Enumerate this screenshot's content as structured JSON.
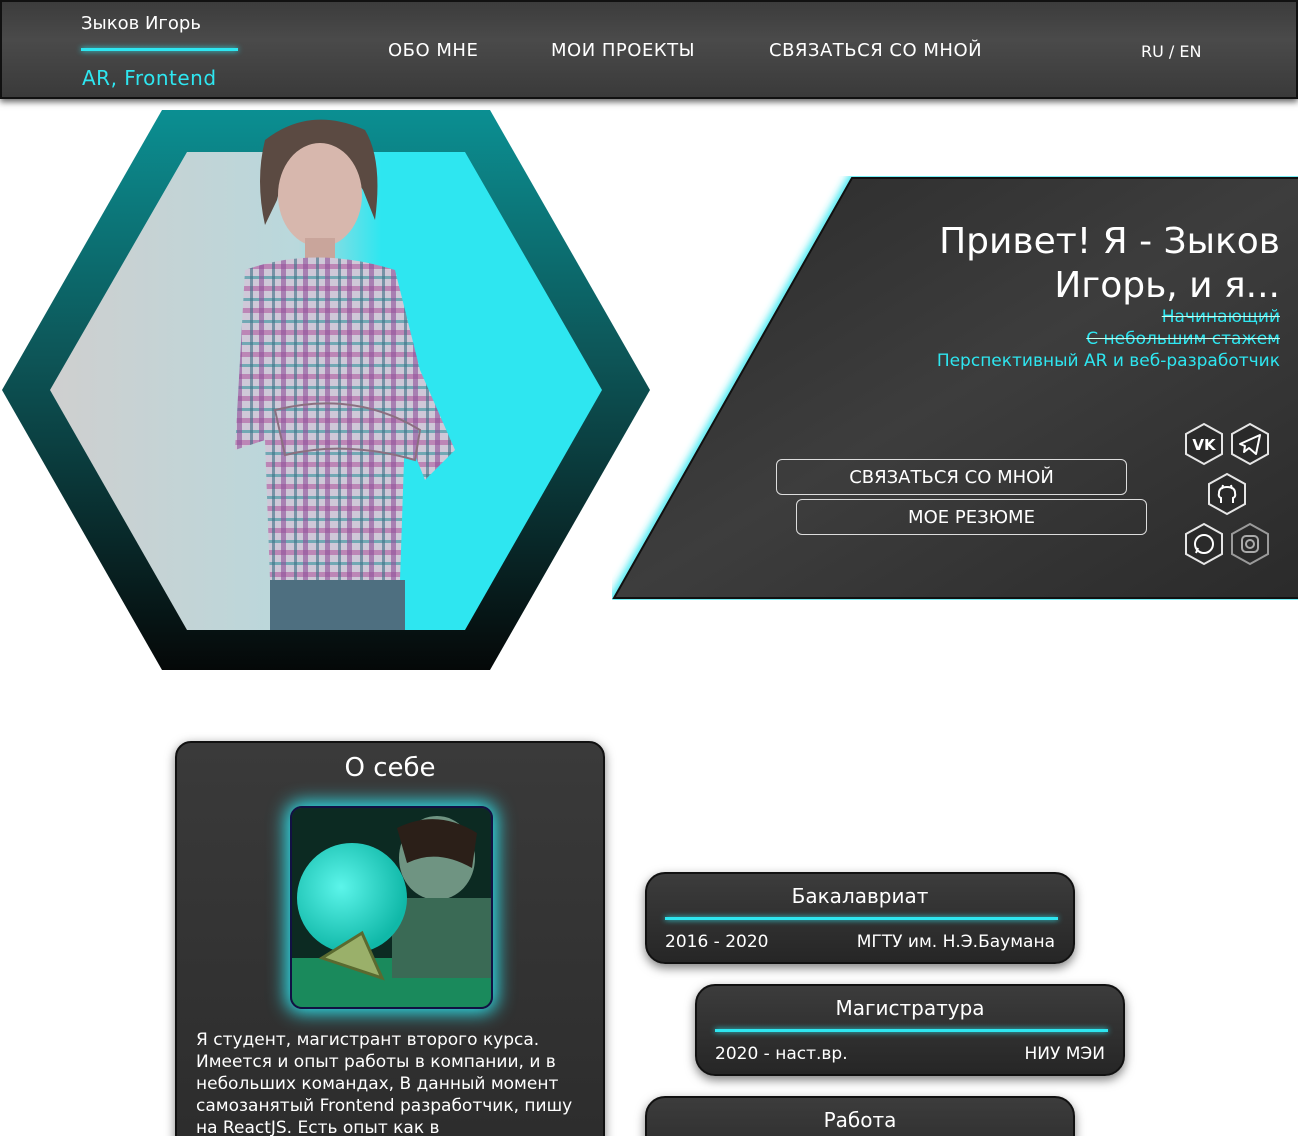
{
  "header": {
    "name": "Зыков Игорь",
    "role": "AR, Frontend",
    "nav": [
      "ОБО МНЕ",
      "МОИ ПРОЕКТЫ",
      "СВЯЗАТЬСЯ СО МНОЙ"
    ],
    "lang": "RU / EN"
  },
  "hero": {
    "title_line1": "Привет! Я - Зыков",
    "title_line2": "Игорь, и я...",
    "tag_1": "Начинающий",
    "tag_2": "С небольшим стажем",
    "tag_3": "Перспективный AR и веб-разработчик",
    "contact_button": "СВЯЗАТЬСЯ СО МНОЙ",
    "resume_button": "МОЕ РЕЗЮМЕ",
    "socials": [
      "vk-icon",
      "telegram-icon",
      "github-icon",
      "whatsapp-icon",
      "instagram-icon"
    ]
  },
  "about": {
    "title": "О себе",
    "text": "Я студент, магистрант второго курса. Имеется и опыт работы в компании, и в небольших командах, В данный момент самозанятый Frontend разработчик, пишу на ReactJS. Есть опыт как в"
  },
  "education": [
    {
      "title": "Бакалавриат",
      "years": "2016 - 2020",
      "place": "МГТУ им. Н.Э.Баумана"
    },
    {
      "title": "Магистратура",
      "years": "2020 - наст.вр.",
      "place": "НИУ МЭИ"
    },
    {
      "title": "Работа"
    }
  ],
  "colors": {
    "accent": "#2ee6f0",
    "panel": "#333333",
    "dark": "#111111"
  }
}
